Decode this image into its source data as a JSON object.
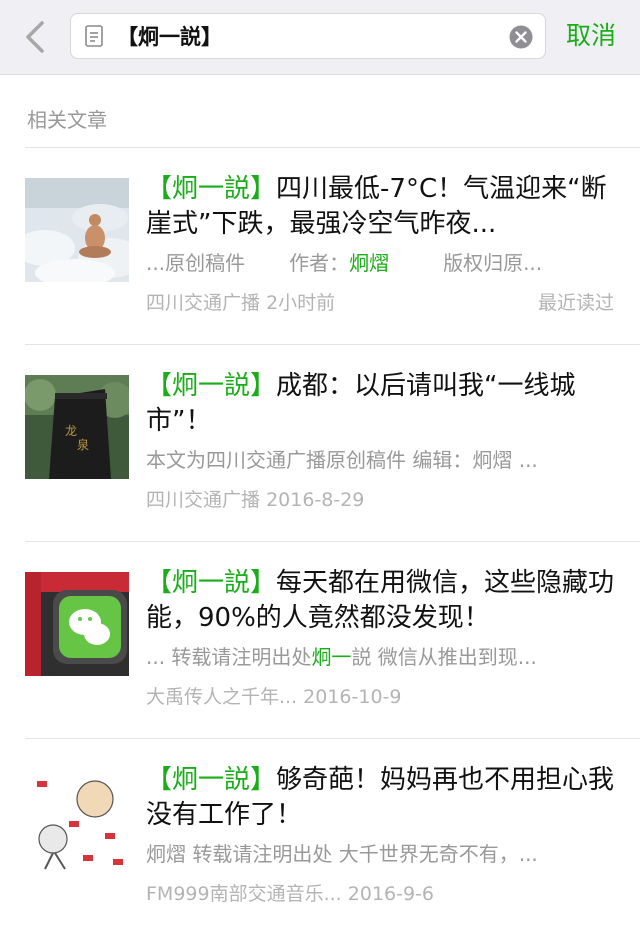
{
  "search": {
    "query": "【炯一説】",
    "cancel_label": "取消"
  },
  "section": {
    "title": "相关文章"
  },
  "articles": [
    {
      "tag": "【炯一説】",
      "title": "四川最低-7°C！气温迎来“断崖式”下跌，最强冷空气昨夜...",
      "snippet_a": "...原创稿件",
      "snippet_b": "作者：",
      "snippet_hl": "炯熠",
      "snippet_c": "版权归原...",
      "source": "四川交通广播",
      "time": "2小时前",
      "recent": "最近读过"
    },
    {
      "tag": "【炯一説】",
      "title": "成都：以后请叫我“一线城市”！",
      "snippet_a": "本文为四川交通广播原创稿件 编辑：炯熠 ...",
      "source": "四川交通广播",
      "time": "2016-8-29"
    },
    {
      "tag": "【炯一説】",
      "title": "每天都在用微信，这些隐藏功能，90%的人竟然都没发现！",
      "snippet_a": "... 转载请注明出处",
      "snippet_hl": "炯一",
      "snippet_c": "説 微信从推出到现...",
      "source": "大禹传人之千年...",
      "time": "2016-10-9"
    },
    {
      "tag": "【炯一説】",
      "title": "够奇葩！妈妈再也不用担心我没有工作了！",
      "snippet_a": "炯熠 转载请注明出处 大千世界无奇不有，...",
      "source": "FM999南部交通音乐...",
      "time": "2016-9-6"
    }
  ],
  "colors": {
    "accent": "#1aad19",
    "muted": "#999999",
    "topbar_bg": "#efeff4"
  },
  "icons": {
    "back": "chevron-left-icon",
    "doc": "document-icon",
    "clear": "clear-circle-icon"
  }
}
